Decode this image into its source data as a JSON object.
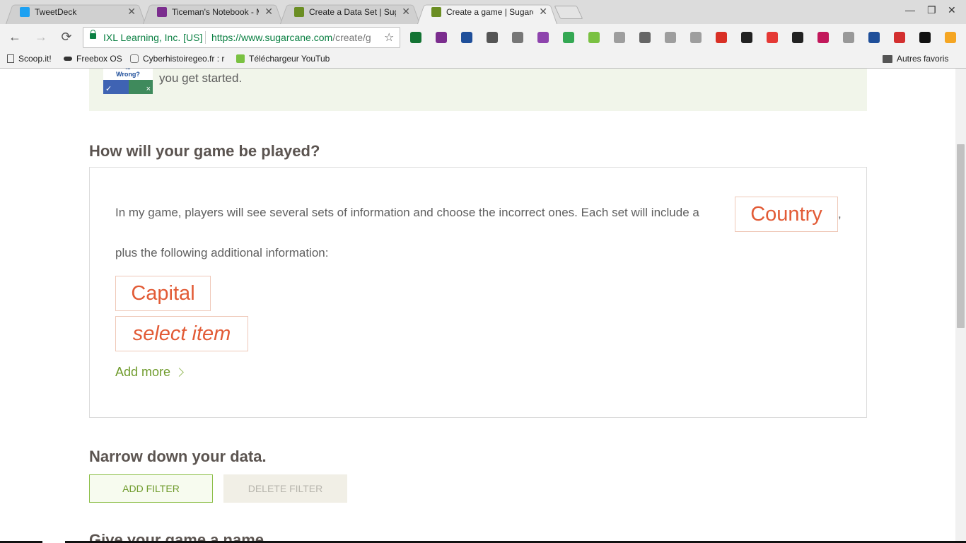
{
  "tabs": [
    {
      "title": "TweetDeck",
      "favicon_color": "#1da1f2",
      "close": "✕"
    },
    {
      "title": "Ticeman's Notebook - M",
      "favicon_color": "#7b2d8e",
      "close": "✕"
    },
    {
      "title": "Create a Data Set | Suga",
      "favicon_color": "#6b8e23",
      "close": "✕"
    },
    {
      "title": "Create a game | Sugarc",
      "favicon_color": "#6b8e23",
      "close": "✕"
    }
  ],
  "window_controls": {
    "minimize": "—",
    "restore": "❐",
    "close": "✕"
  },
  "nav": {
    "back": "←",
    "forward": "→",
    "reload": "⟳"
  },
  "address": {
    "security_label": "IXL Learning, Inc. [US]",
    "url_scheme_host": "https://www.sugarcane.com",
    "url_path": "/create/g",
    "star": "☆"
  },
  "extensions": [
    {
      "name": "extension-icon-1",
      "color": "#137333"
    },
    {
      "name": "onenote-icon",
      "color": "#7b2d8e"
    },
    {
      "name": "k-icon",
      "color": "#1f4f9a"
    },
    {
      "name": "puzzle-icon",
      "color": "#555555"
    },
    {
      "name": "camera-icon",
      "color": "#777777"
    },
    {
      "name": "feather-icon",
      "color": "#8e44ad"
    },
    {
      "name": "printer-icon",
      "color": "#34a853"
    },
    {
      "name": "circle-icon",
      "color": "#7ac142"
    },
    {
      "name": "gif-icon",
      "color": "#9e9e9e"
    },
    {
      "name": "n-icon",
      "color": "#666666"
    },
    {
      "name": "stack-icon",
      "color": "#9e9e9e"
    },
    {
      "name": "rss-icon",
      "color": "#9e9e9e"
    },
    {
      "name": "broadcast-icon",
      "color": "#d93025"
    },
    {
      "name": "qr-icon",
      "color": "#222222"
    },
    {
      "name": "opera-icon",
      "color": "#e53935"
    },
    {
      "name": "qr-icon-2",
      "color": "#222222"
    },
    {
      "name": "record-icon",
      "color": "#c2185b"
    },
    {
      "name": "ankh-icon",
      "color": "#999999"
    },
    {
      "name": "book-icon",
      "color": "#1f4f9a"
    },
    {
      "name": "video-icon",
      "color": "#d32f2f"
    },
    {
      "name": "star-icon",
      "color": "#111111"
    },
    {
      "name": "orange-icon",
      "color": "#f5a623"
    }
  ],
  "bookmarks": [
    {
      "label": "Scoop.it!"
    },
    {
      "label": "Freebox OS"
    },
    {
      "label": "Cyberhistoiregeo.fr : r"
    },
    {
      "label": "Téléchargeur YouTub"
    },
    {
      "label": "Autres favoris"
    }
  ],
  "banner": {
    "logo_text": "Is Wrong?",
    "logo_check": "✓",
    "logo_x": "×",
    "text": "you get started."
  },
  "section_play": {
    "heading": "How will your game be played?",
    "sentence_1": "In my game, players will see several sets of information and choose the incorrect ones. Each set will include a",
    "main_field": "Country",
    "comma": ",",
    "sentence_2": "plus the following additional information:",
    "extra_fields": [
      "Capital",
      "select item"
    ],
    "add_more": "Add more"
  },
  "section_filter": {
    "heading": "Narrow down your data.",
    "add_filter": "ADD FILTER",
    "delete_filter": "DELETE FILTER"
  },
  "section_name": {
    "heading": "Give your game a name"
  }
}
